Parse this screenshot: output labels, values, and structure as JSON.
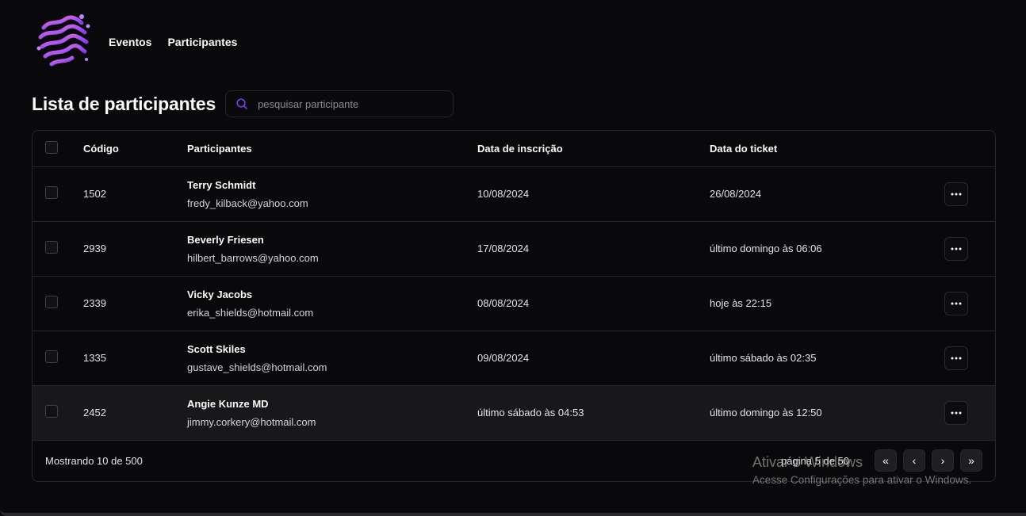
{
  "nav": {
    "logo_icon": "abstract-wave-logo",
    "items": [
      {
        "label": "Eventos"
      },
      {
        "label": "Participantes"
      }
    ]
  },
  "page": {
    "title": "Lista de participantes",
    "search": {
      "placeholder": "pesquisar participante",
      "value": "",
      "icon": "search-icon"
    }
  },
  "table": {
    "headers": {
      "code": "Código",
      "participants": "Participantes",
      "signup_date": "Data de inscrição",
      "ticket_date": "Data do ticket"
    },
    "rows": [
      {
        "code": "1502",
        "name": "Terry Schmidt",
        "email": "fredy_kilback@yahoo.com",
        "signup": "10/08/2024",
        "ticket": "26/08/2024"
      },
      {
        "code": "2939",
        "name": "Beverly Friesen",
        "email": "hilbert_barrows@yahoo.com",
        "signup": "17/08/2024",
        "ticket": "último domingo às 06:06"
      },
      {
        "code": "2339",
        "name": "Vicky Jacobs",
        "email": "erika_shields@hotmail.com",
        "signup": "08/08/2024",
        "ticket": "hoje às 22:15"
      },
      {
        "code": "1335",
        "name": "Scott Skiles",
        "email": "gustave_shields@hotmail.com",
        "signup": "09/08/2024",
        "ticket": "último sábado às 02:35"
      },
      {
        "code": "2452",
        "name": "Angie Kunze MD",
        "email": "jimmy.corkery@hotmail.com",
        "signup": "último sábado às 04:53",
        "ticket": "último domingo às 12:50"
      }
    ],
    "row_action_icon": "more-horizontal-icon"
  },
  "footer": {
    "showing": "Mostrando 10 de 500",
    "page_info": "página 5 de 50",
    "buttons": {
      "first": "«",
      "prev": "‹",
      "next": "›",
      "last": "»"
    }
  },
  "watermark": {
    "title": "Ativar o Windows",
    "subtitle": "Acesse Configurações para ativar o Windows."
  },
  "colors": {
    "background": "#09090b",
    "border": "#27272a",
    "accent": "#7c3aed",
    "logo_pink": "#f472b6",
    "logo_purple": "#8b5cf6"
  }
}
